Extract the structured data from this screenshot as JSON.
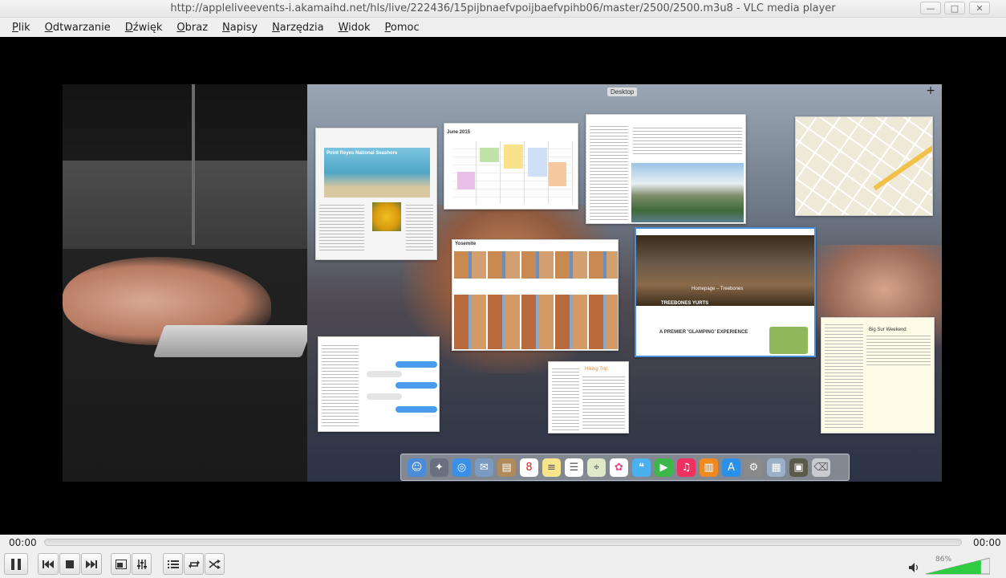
{
  "window": {
    "title": "http://appleliveevents-i.akamaihd.net/hls/live/222436/15pijbnaefvpoijbaefvpihb06/master/2500/2500.m3u8 - VLC media player",
    "controls": [
      "minimize-icon",
      "maximize-icon",
      "close-icon"
    ]
  },
  "menu": [
    {
      "first": "P",
      "rest": "lik"
    },
    {
      "first": "O",
      "rest": "dtwarzanie"
    },
    {
      "first": "D",
      "rest": "źwięk"
    },
    {
      "first": "O",
      "rest": "braz"
    },
    {
      "first": "N",
      "rest": "apisy"
    },
    {
      "first": "N",
      "rest": "arzędzia"
    },
    {
      "first": "W",
      "rest": "idok"
    },
    {
      "first": "P",
      "rest": "omoc"
    }
  ],
  "video": {
    "desktop_label": "Desktop",
    "add_space": "+",
    "windows": {
      "news": "Point Reyes National Seashore",
      "calendar": "June 2015",
      "photos_a": "Yosemite",
      "hotel_title": "Homepage – Treebones",
      "hotel_brand": "TREEBONES YURTS",
      "hotel_tagline": "A PREMIER 'GLAMPING' EXPERIENCE",
      "reminders": "Hiking Trip",
      "notes": "Big Sur Weekend"
    }
  },
  "playback": {
    "elapsed": "00:00",
    "total": "00:00",
    "progress": 0.0,
    "volume_text": "86%",
    "volume": 0.86
  },
  "icons": {
    "pause": "pause-icon",
    "prev": "previous-icon",
    "stop": "stop-icon",
    "next": "next-icon",
    "fullscreen": "fullscreen-icon",
    "extended": "extended-settings-icon",
    "playlist": "playlist-icon",
    "loop": "loop-icon",
    "random": "shuffle-icon",
    "volume": "speaker-icon"
  },
  "colors": {
    "accent_volume": "#2ecc40",
    "video_bg": "#000000"
  }
}
